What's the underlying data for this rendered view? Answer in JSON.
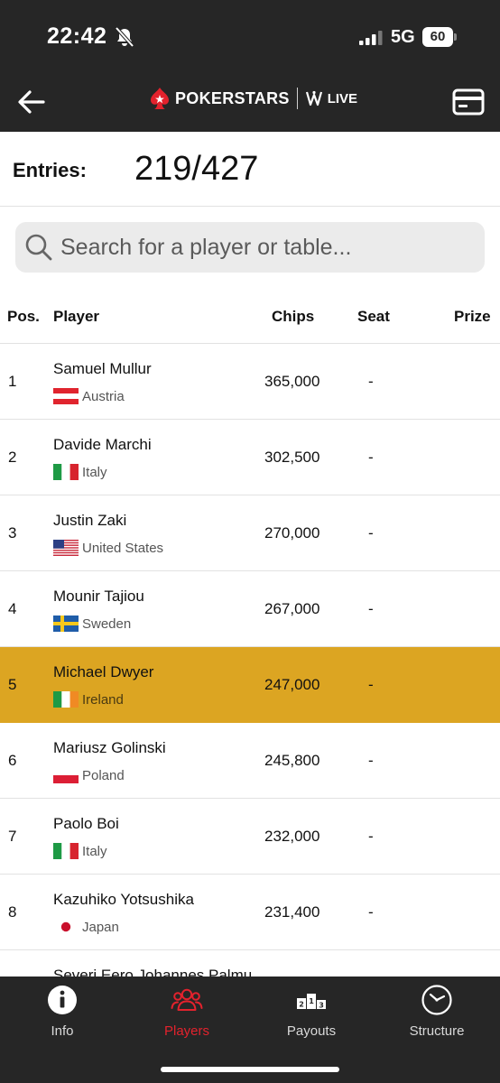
{
  "status": {
    "time": "22:42",
    "network": "5G",
    "battery": "60"
  },
  "header": {
    "logo_text": "POKERSTARS",
    "logo_sub": "LIVE"
  },
  "entries": {
    "label": "Entries:",
    "value": "219/427"
  },
  "search": {
    "placeholder": "Search for a player or table..."
  },
  "table": {
    "headers": {
      "pos": "Pos.",
      "player": "Player",
      "chips": "Chips",
      "seat": "Seat",
      "prize": "Prize"
    },
    "rows": [
      {
        "pos": "1",
        "name": "Samuel Mullur",
        "country": "Austria",
        "flag": "austria-flag-icon",
        "chips": "365,000",
        "seat": "-"
      },
      {
        "pos": "2",
        "name": "Davide Marchi",
        "country": "Italy",
        "flag": "italy-flag-icon",
        "chips": "302,500",
        "seat": "-"
      },
      {
        "pos": "3",
        "name": "Justin Zaki",
        "country": "United States",
        "flag": "usa-flag-icon",
        "chips": "270,000",
        "seat": "-"
      },
      {
        "pos": "4",
        "name": "Mounir Tajiou",
        "country": "Sweden",
        "flag": "sweden-flag-icon",
        "chips": "267,000",
        "seat": "-"
      },
      {
        "pos": "5",
        "name": "Michael Dwyer",
        "country": "Ireland",
        "flag": "ireland-flag-icon",
        "chips": "247,000",
        "seat": "-"
      },
      {
        "pos": "6",
        "name": "Mariusz Golinski",
        "country": "Poland",
        "flag": "poland-flag-icon",
        "chips": "245,800",
        "seat": "-"
      },
      {
        "pos": "7",
        "name": "Paolo Boi",
        "country": "Italy",
        "flag": "italy-flag-icon",
        "chips": "232,000",
        "seat": "-"
      },
      {
        "pos": "8",
        "name": "Kazuhiko Yotsushika",
        "country": "Japan",
        "flag": "japan-flag-icon",
        "chips": "231,400",
        "seat": "-"
      },
      {
        "pos": "",
        "name": "Severi Eero Johannes Palmu"
      }
    ],
    "highlight_color": "#dca522"
  },
  "tabs": [
    {
      "label": "Info",
      "icon": "info-icon"
    },
    {
      "label": "Players",
      "icon": "players-icon",
      "active": true
    },
    {
      "label": "Payouts",
      "icon": "podium-icon"
    },
    {
      "label": "Structure",
      "icon": "clock-icon"
    }
  ],
  "colors": {
    "header_bg": "#262626",
    "accent_red": "#e3222d",
    "highlight": "#dca522"
  }
}
